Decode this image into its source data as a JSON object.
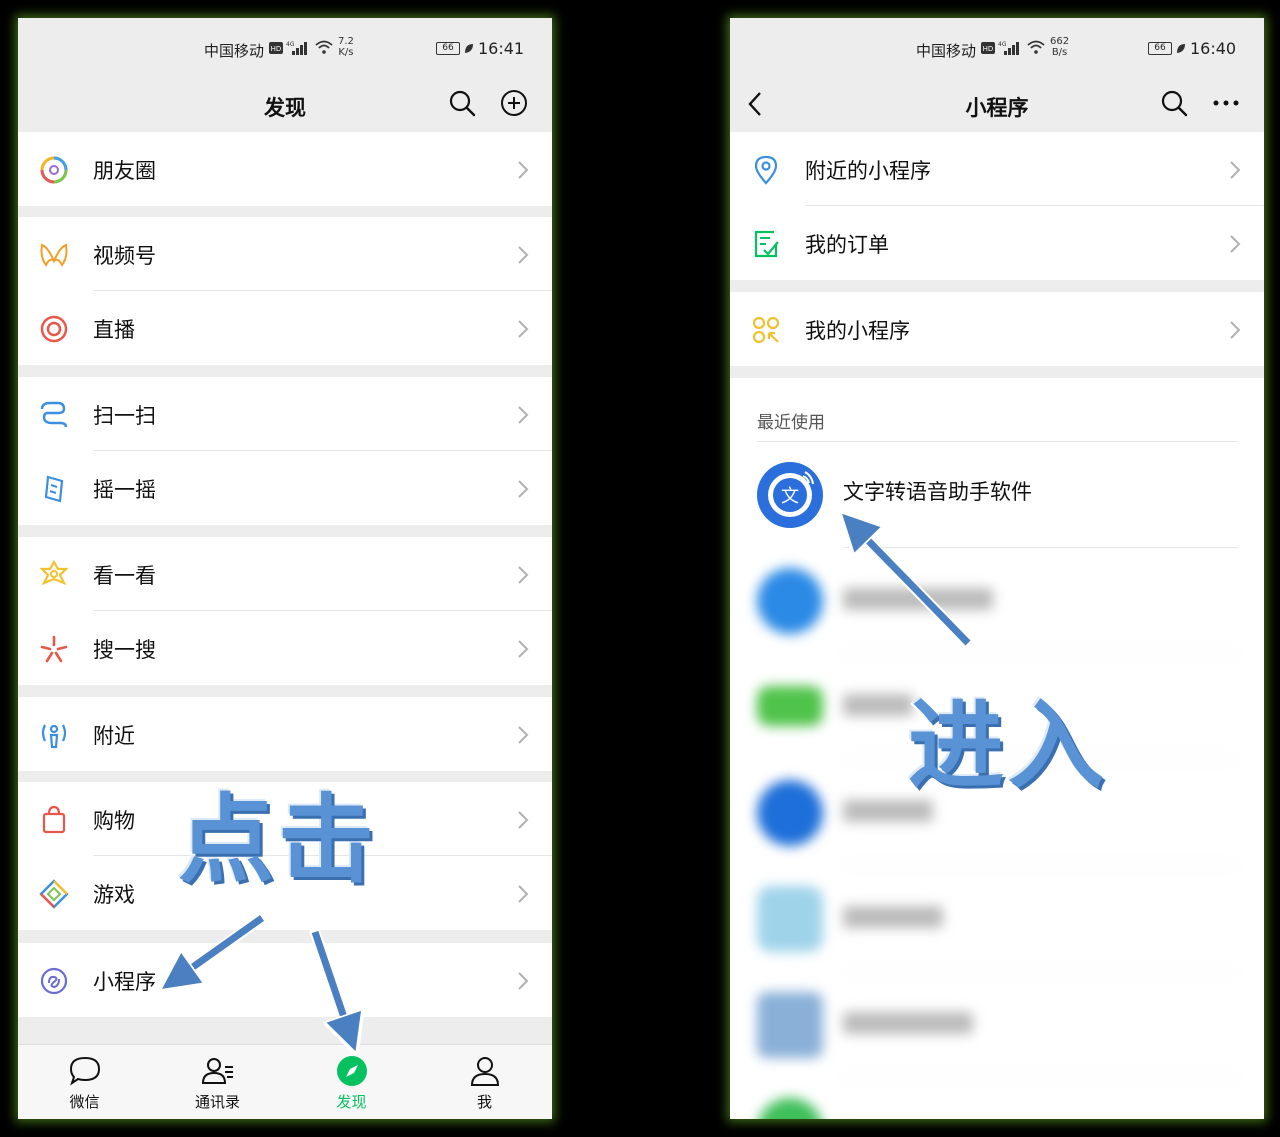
{
  "left_phone": {
    "status": {
      "carrier": "中国移动",
      "net_top": "7.2",
      "net_bottom": "K/s",
      "battery": "66",
      "time": "16:41"
    },
    "title": "发现",
    "rows": [
      {
        "label": "朋友圈",
        "icon": "moments-icon"
      },
      {
        "label": "视频号",
        "icon": "channels-icon"
      },
      {
        "label": "直播",
        "icon": "live-icon"
      },
      {
        "label": "扫一扫",
        "icon": "scan-icon"
      },
      {
        "label": "摇一摇",
        "icon": "shake-icon"
      },
      {
        "label": "看一看",
        "icon": "top-stories-icon"
      },
      {
        "label": "搜一搜",
        "icon": "search-sparkle-icon"
      },
      {
        "label": "附近",
        "icon": "nearby-icon"
      },
      {
        "label": "购物",
        "icon": "shopping-bag-icon"
      },
      {
        "label": "游戏",
        "icon": "games-icon"
      },
      {
        "label": "小程序",
        "icon": "mini-program-icon"
      }
    ],
    "tabs": [
      {
        "label": "微信",
        "icon": "chat-bubble-icon"
      },
      {
        "label": "通讯录",
        "icon": "contacts-icon"
      },
      {
        "label": "发现",
        "icon": "compass-icon",
        "active": true
      },
      {
        "label": "我",
        "icon": "person-icon"
      }
    ],
    "annotation": "点击"
  },
  "right_phone": {
    "status": {
      "carrier": "中国移动",
      "net_top": "662",
      "net_bottom": "B/s",
      "battery": "66",
      "time": "16:40"
    },
    "title": "小程序",
    "rows": [
      {
        "label": "附近的小程序",
        "icon": "location-pin-icon"
      },
      {
        "label": "我的订单",
        "icon": "order-check-icon"
      },
      {
        "label": "我的小程序",
        "icon": "my-mini-programs-icon"
      }
    ],
    "recent_header": "最近使用",
    "recent": [
      {
        "name": "文字转语音助手软件",
        "color": "#2a6fdc"
      }
    ],
    "annotation": "进入"
  },
  "colors": {
    "accent_green": "#07c160",
    "arrow_blue": "#4a7fc1",
    "page_bg": "#ededed"
  }
}
